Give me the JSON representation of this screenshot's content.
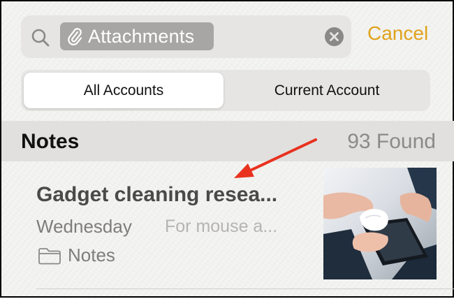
{
  "search": {
    "token_label": "Attachments",
    "cancel_label": "Cancel"
  },
  "scope": {
    "options": [
      "All Accounts",
      "Current Account"
    ],
    "selected": "All Accounts"
  },
  "section": {
    "title": "Notes",
    "count_text": "93 Found"
  },
  "results": [
    {
      "title": "Gadget cleaning resea...",
      "date": "Wednesday",
      "snippet": "For mouse a...",
      "folder": "Notes"
    }
  ],
  "colors": {
    "accent": "#e0a31b",
    "annotation_arrow": "#e8321f"
  },
  "icons": [
    "search-icon",
    "paperclip-icon",
    "clear-icon",
    "folder-icon"
  ]
}
